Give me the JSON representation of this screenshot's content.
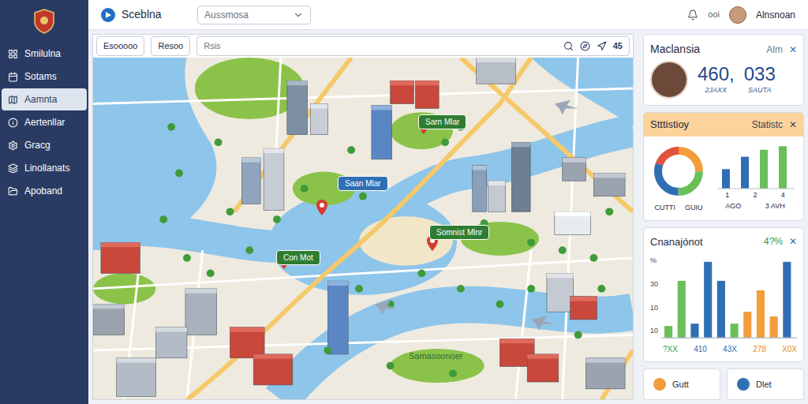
{
  "app": {
    "title": "Sceblna"
  },
  "topbar": {
    "dropdown": "Aussmosa",
    "user_label": "ooi",
    "user_name": "Alnsnoan"
  },
  "sidebar": {
    "items": [
      {
        "label": "Smilulna",
        "selected": false
      },
      {
        "label": "Sotams",
        "selected": false
      },
      {
        "label": "Aamnta",
        "selected": true
      },
      {
        "label": "Aertenllar",
        "selected": false
      },
      {
        "label": "Gracg",
        "selected": false
      },
      {
        "label": "Linollanats",
        "selected": false
      },
      {
        "label": "Apoband",
        "selected": false
      }
    ]
  },
  "map_toolbar": {
    "buttons": [
      "Esooooo",
      "Resoo"
    ],
    "search": "Rsis",
    "badge": "45"
  },
  "map": {
    "labels": [
      {
        "text": "Sarn Mlar",
        "color": "#2e7d32"
      },
      {
        "text": "Saan Mlar",
        "color": "#2f6fb3"
      },
      {
        "text": "Somnist Mlnr",
        "color": "#2e7d32"
      },
      {
        "text": "Con Mot",
        "color": "#2e7d32"
      }
    ],
    "caption": "Samasoonoer"
  },
  "profile_card": {
    "title": "Maclansia",
    "action": "Alm",
    "close": "✕",
    "stats": [
      {
        "value": "460,",
        "caption": "2JAXX"
      },
      {
        "value": "033",
        "caption": "SAUTA"
      }
    ]
  },
  "statistics_card": {
    "title": "Stttistioy",
    "action": "Statistc",
    "close": "✕",
    "donut": [
      {
        "value": 25,
        "color": "#f39c3c"
      },
      {
        "value": 25,
        "color": "#6bbf59"
      },
      {
        "value": 30,
        "color": "#2f6fb3"
      },
      {
        "value": 20,
        "color": "#e0533d"
      }
    ],
    "donut_labels": [
      "CUTTI",
      "GUIU"
    ],
    "bars": [
      {
        "value": 22,
        "color": "#2f6fb3"
      },
      {
        "value": 36,
        "color": "#2f6fb3"
      },
      {
        "value": 44,
        "color": "#6bbf59"
      },
      {
        "value": 48,
        "color": "#6bbf59"
      }
    ],
    "bar_max": 50,
    "bar_ticks": [
      "1",
      "2",
      "4"
    ],
    "bar_captions": [
      "AGO",
      "3 AVH"
    ]
  },
  "change_card": {
    "title": "Cnanajónot",
    "badge": "4?%",
    "close": "✕",
    "y_ticks": [
      "%",
      "30",
      "10",
      "10"
    ],
    "bars": [
      {
        "value": 10,
        "color": "#6bbf59"
      },
      {
        "value": 48,
        "color": "#6bbf59"
      },
      {
        "value": 12,
        "color": "#2f6fb3"
      },
      {
        "value": 64,
        "color": "#2f6fb3"
      },
      {
        "value": 48,
        "color": "#2f6fb3"
      },
      {
        "value": 12,
        "color": "#6bbf59"
      },
      {
        "value": 22,
        "color": "#f39c3c"
      },
      {
        "value": 40,
        "color": "#f39c3c"
      },
      {
        "value": 18,
        "color": "#f39c3c"
      },
      {
        "value": 64,
        "color": "#2f6fb3"
      }
    ],
    "bar_max": 70,
    "x_labels": [
      {
        "text": "?XX",
        "color": "#2e9e4f"
      },
      {
        "text": "410",
        "color": "#2f6fb3"
      },
      {
        "text": "43X",
        "color": "#2f6fb3"
      },
      {
        "text": "278",
        "color": "#e08a1e"
      },
      {
        "text": "X0X",
        "color": "#e08a1e"
      }
    ]
  },
  "legend": [
    {
      "label": "Gutt",
      "color": "#f39c3c"
    },
    {
      "label": "Dlet",
      "color": "#2f6fb3"
    }
  ]
}
